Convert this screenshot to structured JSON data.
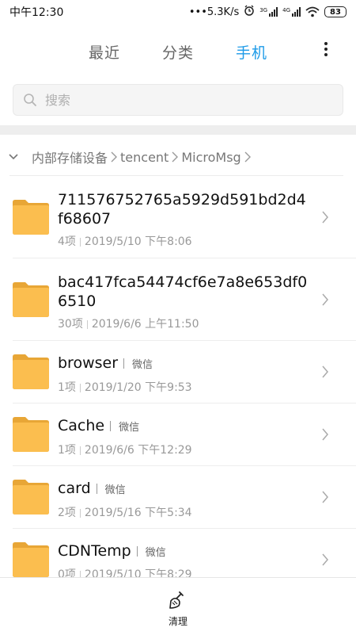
{
  "status_bar": {
    "time": "中午12:30",
    "network_speed": "•••5.3K/s",
    "signal1_label": "3G",
    "signal2_label": "4G",
    "battery": "83"
  },
  "tabs": [
    {
      "label": "最近",
      "active": false
    },
    {
      "label": "分类",
      "active": false
    },
    {
      "label": "手机",
      "active": true
    }
  ],
  "accent_color": "#1e9be8",
  "search": {
    "placeholder": "搜索"
  },
  "breadcrumb": {
    "items": [
      "内部存储设备",
      "tencent",
      "MicroMsg"
    ]
  },
  "files": [
    {
      "name": "711576752765a5929d591bd2d4f68607",
      "source": "",
      "count": "4项",
      "date": "2019/5/10 下午8:06"
    },
    {
      "name": "bac417fca54474cf6e7a8e653df06510",
      "source": "",
      "count": "30项",
      "date": "2019/6/6 上午11:50"
    },
    {
      "name": "browser",
      "source": "微信",
      "count": "1项",
      "date": "2019/1/20 下午9:53"
    },
    {
      "name": "Cache",
      "source": "微信",
      "count": "1项",
      "date": "2019/6/6 下午12:29"
    },
    {
      "name": "card",
      "source": "微信",
      "count": "2项",
      "date": "2019/5/16 下午5:34"
    },
    {
      "name": "CDNTemp",
      "source": "微信",
      "count": "0项",
      "date": "2019/5/10 下午8:29"
    }
  ],
  "bottom_bar": {
    "clean_label": "清理",
    "clean_icon": "broom-icon"
  }
}
